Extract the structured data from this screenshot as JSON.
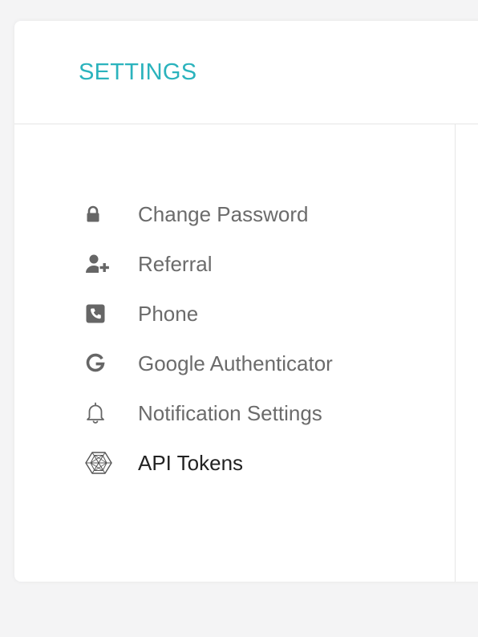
{
  "header": {
    "title": "SETTINGS"
  },
  "colors": {
    "accent": "#2bb3bd",
    "menu_text": "#6b6b6b",
    "menu_text_active": "#222222",
    "icon": "#666666"
  },
  "menu": {
    "items": [
      {
        "label": "Change Password",
        "icon": "lock-icon",
        "active": false
      },
      {
        "label": "Referral",
        "icon": "user-plus-icon",
        "active": false
      },
      {
        "label": "Phone",
        "icon": "phone-icon",
        "active": false
      },
      {
        "label": "Google Authenticator",
        "icon": "google-icon",
        "active": false
      },
      {
        "label": "Notification Settings",
        "icon": "bell-icon",
        "active": false
      },
      {
        "label": "API Tokens",
        "icon": "hexagon-token-icon",
        "active": true
      }
    ]
  }
}
